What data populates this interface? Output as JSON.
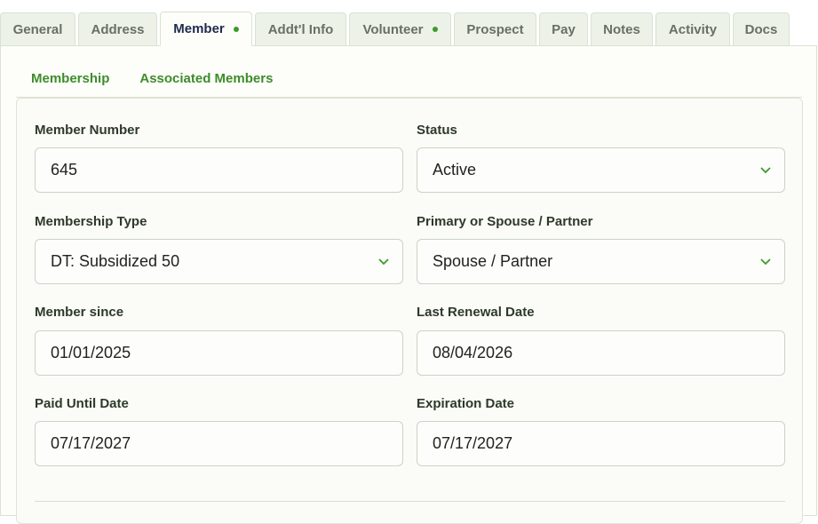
{
  "tabs": [
    {
      "label": "General",
      "active": false,
      "dot": false
    },
    {
      "label": "Address",
      "active": false,
      "dot": false
    },
    {
      "label": "Member",
      "active": true,
      "dot": true
    },
    {
      "label": "Addt'l Info",
      "active": false,
      "dot": false
    },
    {
      "label": "Volunteer",
      "active": false,
      "dot": true
    },
    {
      "label": "Prospect",
      "active": false,
      "dot": false
    },
    {
      "label": "Pay",
      "active": false,
      "dot": false
    },
    {
      "label": "Notes",
      "active": false,
      "dot": false
    },
    {
      "label": "Activity",
      "active": false,
      "dot": false
    },
    {
      "label": "Docs",
      "active": false,
      "dot": false
    }
  ],
  "subtabs": [
    "Membership",
    "Associated Members"
  ],
  "form": {
    "member_number": {
      "label": "Member Number",
      "value": "645"
    },
    "status": {
      "label": "Status",
      "value": "Active"
    },
    "membership_type": {
      "label": "Membership Type",
      "value": "DT: Subsidized 50"
    },
    "primary_or_spouse": {
      "label": "Primary or Spouse / Partner",
      "value": "Spouse / Partner"
    },
    "member_since": {
      "label": "Member since",
      "value": "01/01/2025"
    },
    "last_renewal_date": {
      "label": "Last Renewal Date",
      "value": "08/04/2026"
    },
    "paid_until_date": {
      "label": "Paid Until Date",
      "value": "07/17/2027"
    },
    "expiration_date": {
      "label": "Expiration Date",
      "value": "07/17/2027"
    }
  },
  "colors": {
    "accent_green": "#3d8d2a",
    "dot_green": "#3d9a2a",
    "active_tab_text": "#1f2a4d",
    "tab_bg": "#edf2e8"
  },
  "icons": {
    "select_arrow": "chevron-down-icon"
  }
}
